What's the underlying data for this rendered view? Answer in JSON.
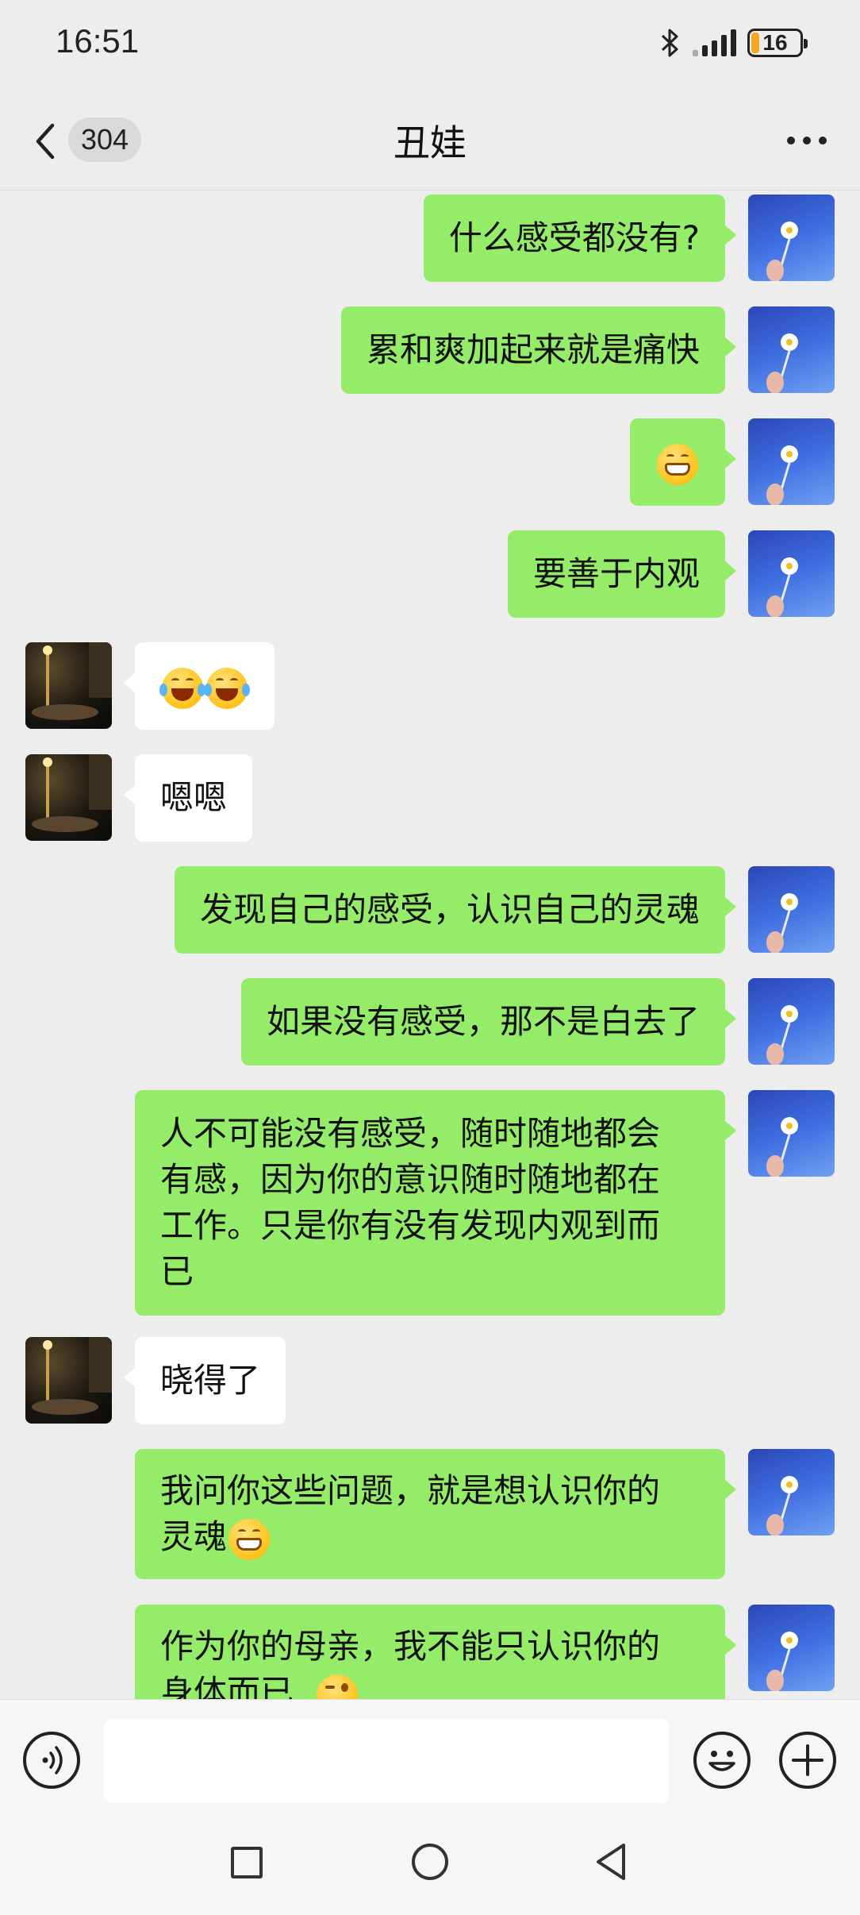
{
  "status_bar": {
    "time": "16:51",
    "battery": "16"
  },
  "header": {
    "unread_count": "304",
    "title": "丑娃"
  },
  "messages": [
    {
      "from": "me",
      "text": "什么感受都没有?"
    },
    {
      "from": "me",
      "text": "累和爽加起来就是痛快"
    },
    {
      "from": "me",
      "emoji": "grinning-face-emoji"
    },
    {
      "from": "me",
      "text": "要善于内观"
    },
    {
      "from": "other",
      "emoji": "tears-of-joy-emoji x2"
    },
    {
      "from": "other",
      "text": "嗯嗯"
    },
    {
      "from": "me",
      "text": "发现自己的感受，认识自己的灵魂"
    },
    {
      "from": "me",
      "text": "如果没有感受，那不是白去了"
    },
    {
      "from": "me",
      "lines": [
        "人不可能没有感受，随时随地都会",
        "有感，因为你的意识随时随地都在",
        "工作。只是你有没有发现内观到而",
        "已"
      ]
    },
    {
      "from": "other",
      "text": "晓得了"
    },
    {
      "from": "me",
      "lines": [
        "我问你这些问题，就是想认识你的",
        "灵魂"
      ],
      "trailing_emoji": "grinning-face-emoji"
    },
    {
      "from": "me",
      "lines": [
        "作为你的母亲，我不能只认识你的",
        "身体而已"
      ],
      "trailing_emoji": "winking-face-emoji"
    }
  ],
  "input": {
    "placeholder": ""
  },
  "icons": {
    "back": "chevron-left-icon",
    "more": "more-icon",
    "voice": "voice-icon",
    "emoji": "emoji-icon",
    "plus": "plus-icon"
  },
  "colors": {
    "my_bubble": "#95ec69",
    "other_bubble": "#ffffff",
    "background": "#ededed"
  }
}
